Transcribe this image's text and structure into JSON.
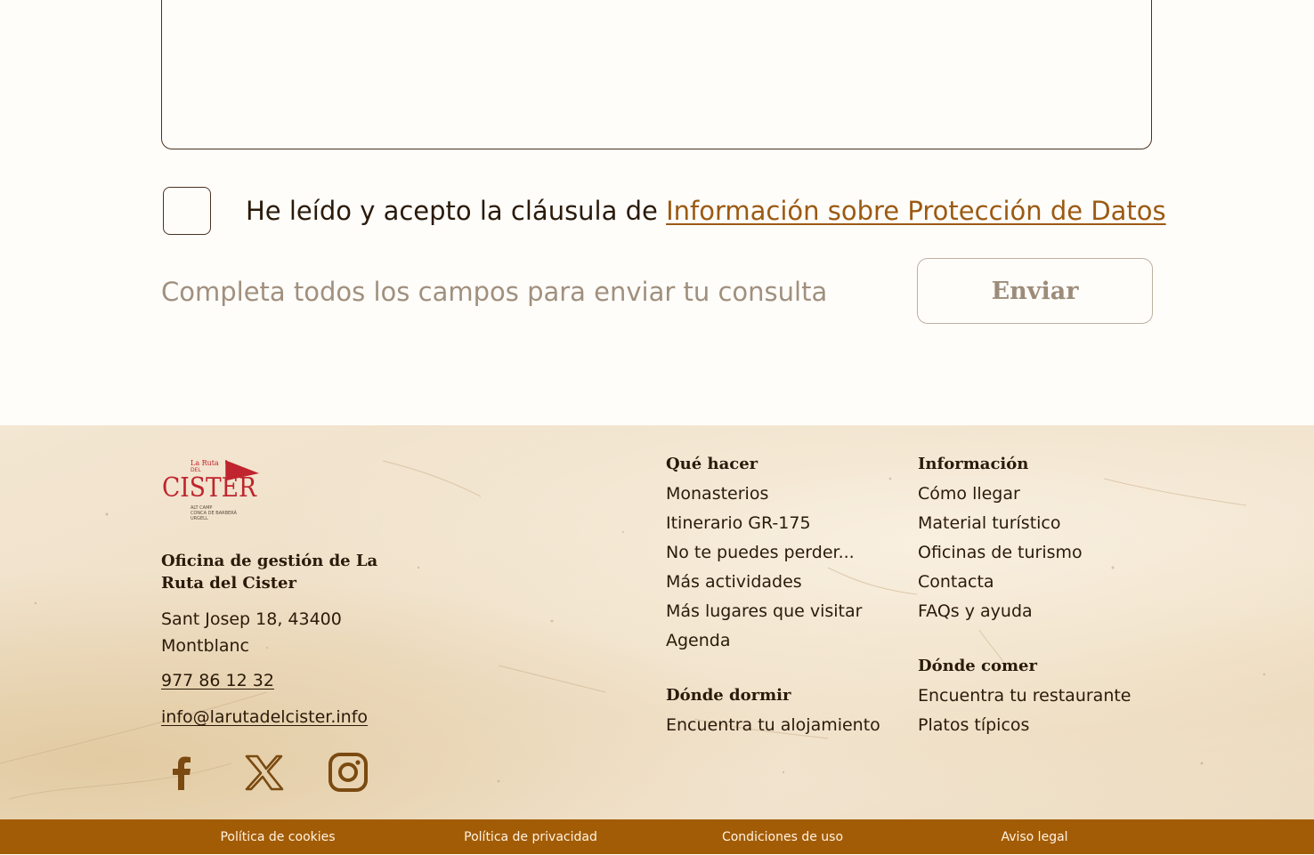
{
  "form": {
    "consent_text": "He leído y acepto la cláusula de ",
    "consent_link": "Información sobre Protección de Datos",
    "hint": "Completa todos los campos para enviar tu consulta",
    "send_label": "Enviar"
  },
  "footer": {
    "logo": {
      "top": "La Ruta",
      "del": "DEL",
      "name": "CISTER",
      "sub1": "ALT CAMP",
      "sub2": "CONCA DE BARBERÀ",
      "sub3": "URGELL"
    },
    "office_title": "Oficina de gestión de La Ruta del Cister",
    "address_line1": "Sant Josep 18, 43400",
    "address_line2": "Montblanc",
    "phone": "977 86 12 32",
    "email": "info@larutadelcister.info",
    "social": [
      "facebook-icon",
      "x-icon",
      "instagram-icon"
    ],
    "que_hacer": {
      "title": "Qué hacer",
      "items": [
        "Monasterios",
        "Itinerario GR-175",
        "No te puedes perder...",
        "Más actividades",
        "Más lugares que visitar",
        "Agenda"
      ]
    },
    "donde_dormir": {
      "title": "Dónde dormir",
      "items": [
        "Encuentra tu alojamiento"
      ]
    },
    "informacion": {
      "title": "Información",
      "items": [
        "Cómo llegar",
        "Material turístico",
        "Oficinas de turismo",
        "Contacta",
        "FAQs y ayuda"
      ]
    },
    "donde_comer": {
      "title": "Dónde comer",
      "items": [
        "Encuentra tu restaurante",
        "Platos típicos"
      ]
    }
  },
  "bottom_bar": {
    "links": [
      "Política de cookies",
      "Política de privacidad",
      "Condiciones de uso",
      "Aviso legal"
    ]
  },
  "colors": {
    "accent": "#a35c06",
    "link": "#9b5a12",
    "text": "#2a1a0a",
    "muted": "#a0907e",
    "logo_red": "#c0242e"
  }
}
